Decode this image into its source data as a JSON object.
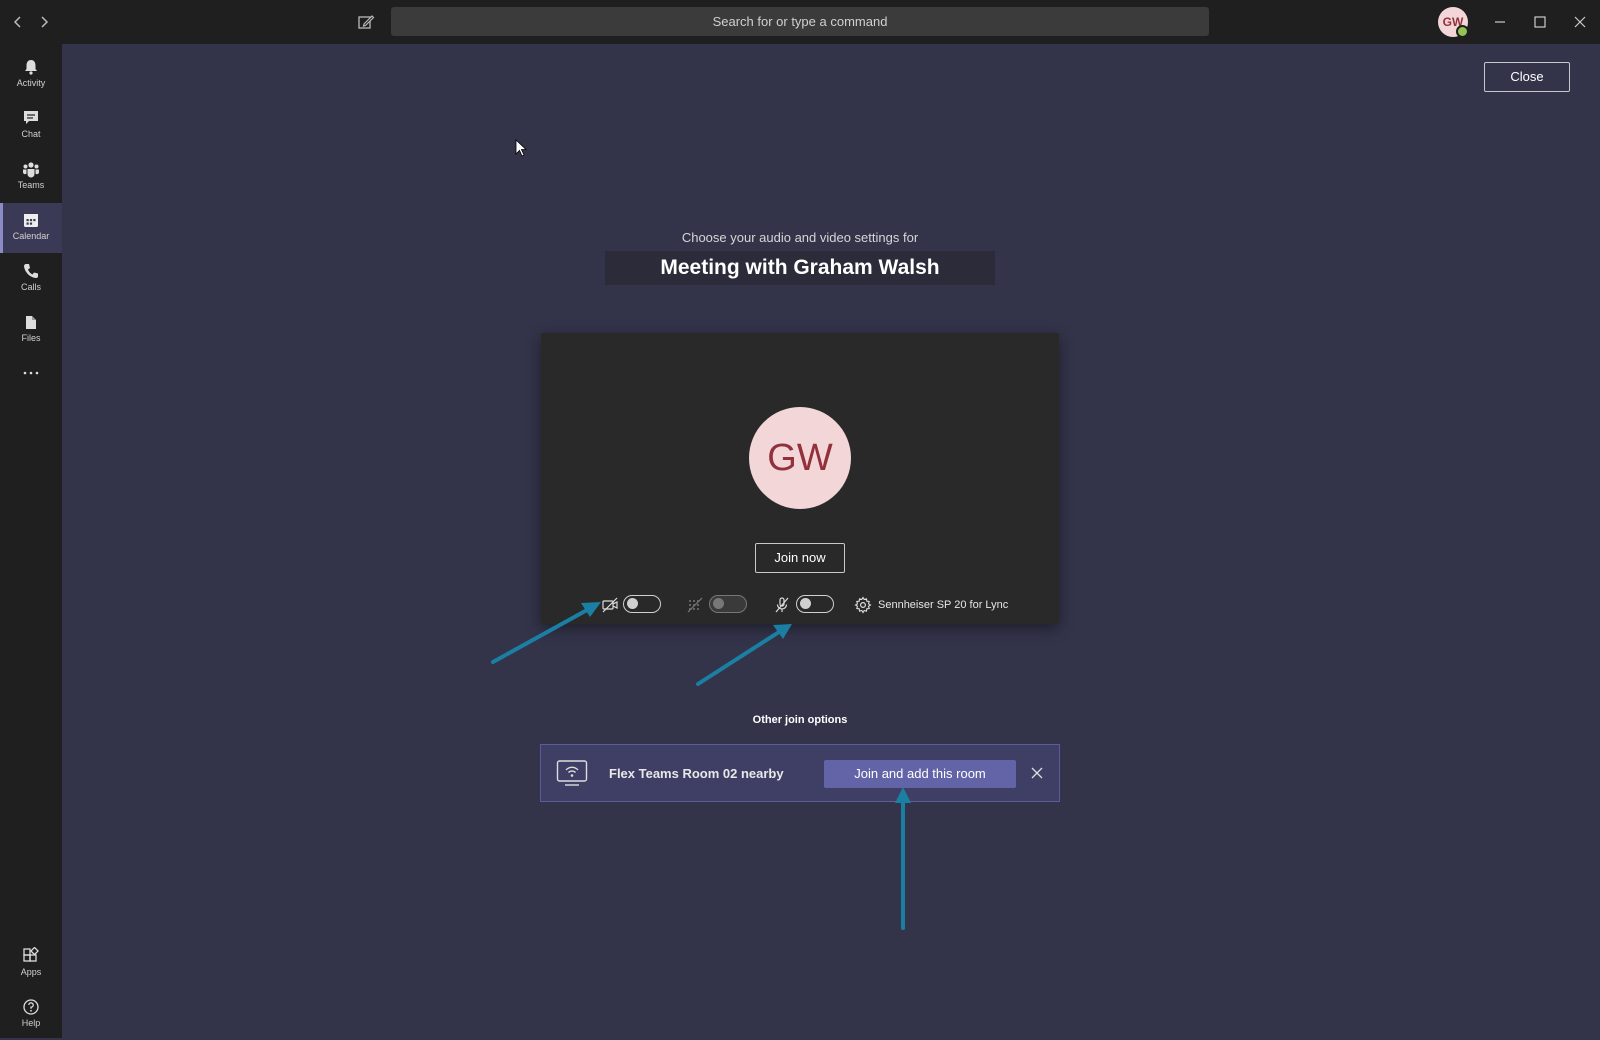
{
  "titlebar": {
    "search_placeholder": "Search for or type a command",
    "avatar_initials": "GW"
  },
  "rail": {
    "items": [
      {
        "label": "Activity",
        "icon": "bell-icon"
      },
      {
        "label": "Chat",
        "icon": "chat-icon"
      },
      {
        "label": "Teams",
        "icon": "teams-icon"
      },
      {
        "label": "Calendar",
        "icon": "calendar-icon",
        "active": true
      },
      {
        "label": "Calls",
        "icon": "phone-icon"
      },
      {
        "label": "Files",
        "icon": "file-icon"
      }
    ],
    "bottom": [
      {
        "label": "Apps",
        "icon": "apps-icon"
      },
      {
        "label": "Help",
        "icon": "help-icon"
      }
    ]
  },
  "page": {
    "close_label": "Close",
    "subtitle": "Choose your audio and video settings for",
    "meeting_title": "Meeting with Graham Walsh"
  },
  "preview": {
    "avatar_initials": "GW",
    "join_now_label": "Join now",
    "device_label": "Sennheiser SP 20 for Lync",
    "video_on": false,
    "blur_on": false,
    "mic_on": false
  },
  "other": {
    "heading": "Other join options",
    "room_label": "Flex Teams Room 02 nearby",
    "join_room_label": "Join and add this room"
  },
  "colors": {
    "accent": "#6264a7",
    "annotation_arrow": "#1b7fa3",
    "background": "#33344a"
  }
}
